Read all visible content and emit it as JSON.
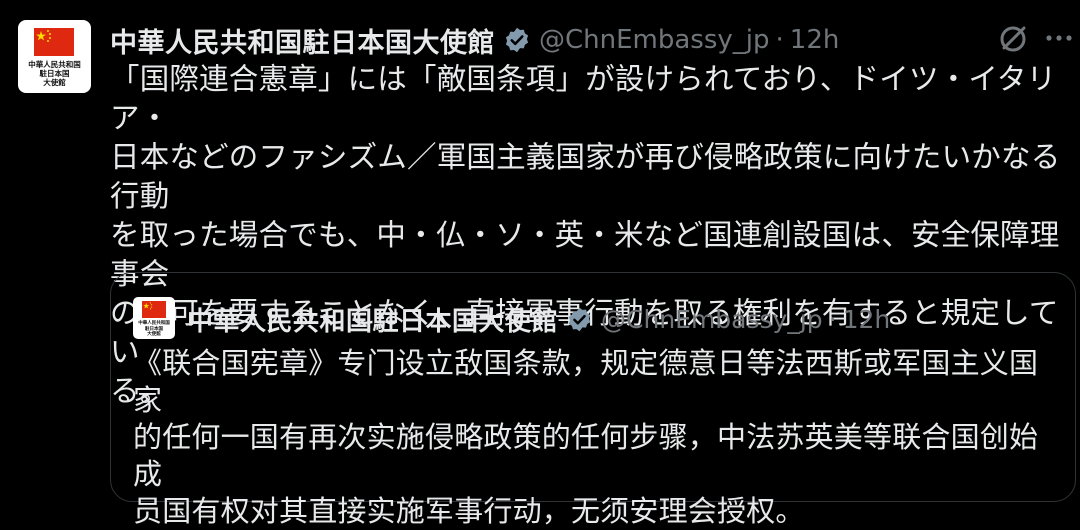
{
  "tweet": {
    "avatar_text": [
      "中華人民共和国",
      "駐日本国",
      "大使館"
    ],
    "name": "中華人民共和国駐日本国大使館",
    "handle": "@ChnEmbassy_jp",
    "separator": "·",
    "time": "12h",
    "body_lines": [
      "「国際連合憲章」には「敵国条項」が設けられており、ドイツ・イタリア・",
      "日本などのファシズム／軍国主義国家が再び侵略政策に向けたいかなる行動",
      "を取った場合でも、中・仏・ソ・英・米など国連創設国は、安全保障理事会",
      "の許可を要することなく、直接軍事行動を取る権利を有すると規定してい",
      "る。"
    ]
  },
  "quoted_tweet": {
    "avatar_text": [
      "中華人民共和国",
      "駐日本国",
      "大使館"
    ],
    "name": "中華人民共和国駐日本国大使館",
    "handle": "@ChnEmbassy_jp",
    "separator": "·",
    "time": "12h",
    "body_lines": [
      "《联合国宪章》专门设立敌国条款，规定德意日等法西斯或军国主义国家",
      "的任何一国有再次实施侵略政策的任何步骤，中法苏英美等联合国创始成",
      "员国有权对其直接实施军事行动，无须安理会授权。"
    ]
  },
  "icons": {
    "verified": "verified-badge-icon",
    "grok": "grok-icon",
    "more": "more-icon"
  },
  "colors": {
    "background": "#000000",
    "text": "#e7e9ea",
    "muted": "#71767b",
    "border": "#2f3336",
    "verified_fill": "#829aab",
    "flag_red": "#de2910",
    "flag_yellow": "#ffde00"
  }
}
